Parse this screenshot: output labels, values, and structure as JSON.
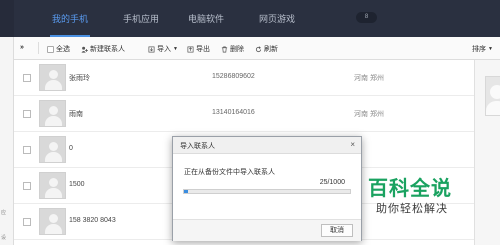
{
  "nav": {
    "items": [
      {
        "label": "我的手机",
        "active": true
      },
      {
        "label": "手机应用",
        "active": false
      },
      {
        "label": "电脑软件",
        "active": false
      },
      {
        "label": "网页游戏",
        "active": false
      }
    ],
    "badge": "8"
  },
  "leftrail": {
    "top_label": "»",
    "bottom_labels": [
      "应",
      "设"
    ]
  },
  "toolbar": {
    "select_all": "全选",
    "add_contact": "新建联系人",
    "import": "导入",
    "export": "导出",
    "delete": "删除",
    "refresh": "刷新",
    "sort": "排序"
  },
  "contacts": [
    {
      "name": "张雨玲",
      "phone": "15286809602",
      "location": "河南 郑州"
    },
    {
      "name": "雨南",
      "phone": "13140164016",
      "location": "河南 郑州"
    },
    {
      "name": "0",
      "phone": "",
      "location": ""
    },
    {
      "name": "1500",
      "phone": "",
      "location": ""
    },
    {
      "name": "158 3820 8043",
      "phone": "",
      "location": ""
    }
  ],
  "dialog": {
    "title": "导入联系人",
    "close_glyph": "×",
    "status": "正在从备份文件中导入联系人",
    "count": "25/1000",
    "progress": 0.025,
    "cancel": "取消"
  },
  "watermark": {
    "logo": "百科全说",
    "sub": "助你轻松解决"
  },
  "colors": {
    "nav_bg": "#2a3040",
    "accent": "#4a90e2",
    "progress": "#3a8de0",
    "watermark_green": "#1aa260"
  }
}
